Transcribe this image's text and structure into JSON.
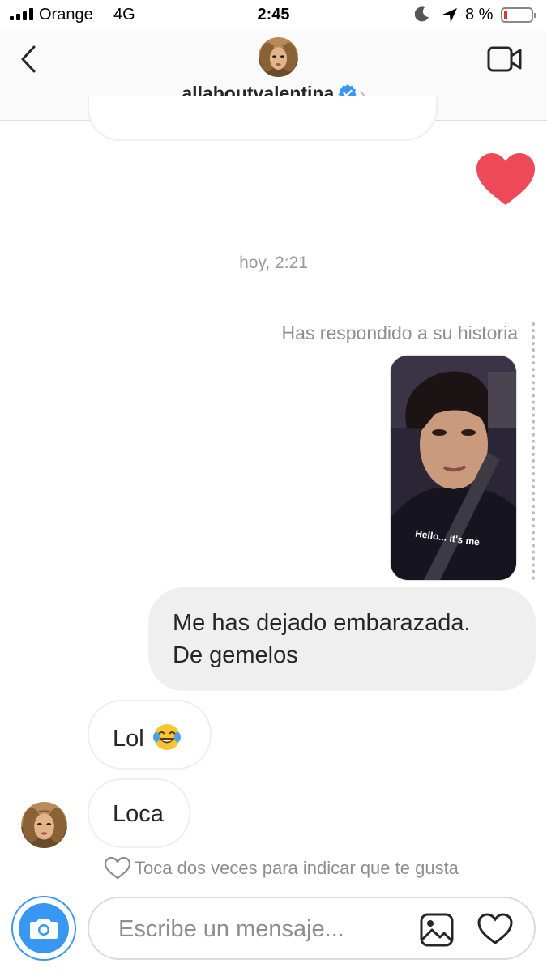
{
  "status_bar": {
    "carrier": "Orange",
    "network": "4G",
    "time": "2:45",
    "battery": "8 %",
    "battery_level": 0.08
  },
  "header": {
    "username": "allaboutvalentina",
    "verified": true,
    "icons": [
      "back-arrow-icon",
      "video-call-icon",
      "verified-badge-icon"
    ]
  },
  "conversation": {
    "timestamp": "hoy, 2:21",
    "reply_note": "Has respondido a su historia",
    "story_caption": "Hello... it's me",
    "sent_message": {
      "line1": "Me has dejado embarazada.",
      "line2": "De gemelos"
    },
    "received": [
      {
        "text": "Lol",
        "emoji": "tears-of-joy"
      },
      {
        "text": "Loca"
      }
    ],
    "like_hint": "Toca dos veces para indicar que te gusta"
  },
  "composer": {
    "placeholder": "Escribe un mensaje..."
  },
  "colors": {
    "accent_blue": "#3897f0",
    "heart_red": "#ed4956",
    "sent_bubble": "#efefef",
    "muted_text": "#8e8e8e"
  }
}
